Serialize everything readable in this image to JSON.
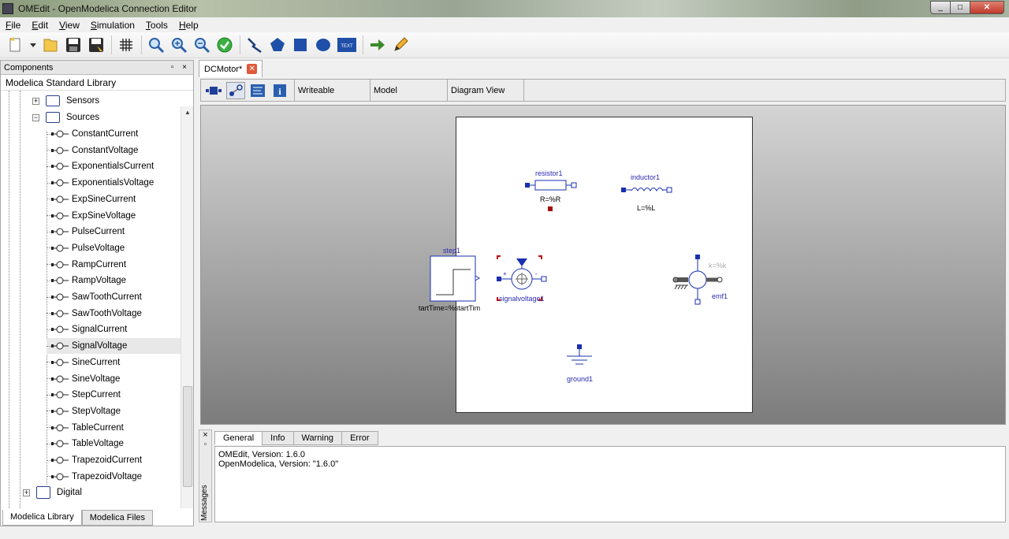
{
  "window": {
    "title": "OMEdit - OpenModelica Connection Editor",
    "min": "_",
    "max": "□",
    "close": "✕"
  },
  "menu": [
    {
      "label": "File",
      "u": "F",
      "rest": "ile"
    },
    {
      "label": "Edit",
      "u": "E",
      "rest": "dit"
    },
    {
      "label": "View",
      "u": "V",
      "rest": "iew"
    },
    {
      "label": "Simulation",
      "u": "S",
      "rest": "imulation"
    },
    {
      "label": "Tools",
      "u": "T",
      "rest": "ools"
    },
    {
      "label": "Help",
      "u": "H",
      "rest": "elp"
    }
  ],
  "toolbar": {
    "text_tool": "TEXT"
  },
  "components_panel": {
    "title": "Components",
    "controls": "▫ ×",
    "library_title": "Modelica Standard Library",
    "packages": [
      "Sensors",
      "Sources"
    ],
    "items": [
      "ConstantCurrent",
      "ConstantVoltage",
      "ExponentialsCurrent",
      "ExponentialsVoltage",
      "ExpSineCurrent",
      "ExpSineVoltage",
      "PulseCurrent",
      "PulseVoltage",
      "RampCurrent",
      "RampVoltage",
      "SawToothCurrent",
      "SawToothVoltage",
      "SignalCurrent",
      "SignalVoltage",
      "SineCurrent",
      "SineVoltage",
      "StepCurrent",
      "StepVoltage",
      "TableCurrent",
      "TableVoltage",
      "TrapezoidCurrent",
      "TrapezoidVoltage"
    ],
    "selected": "SignalVoltage",
    "after_packages": [
      "Digital"
    ],
    "tabs": [
      "Modelica Library",
      "Modelica Files"
    ]
  },
  "editor": {
    "tab_label": "DCMotor*",
    "tab_close": "✕",
    "status": [
      "Writeable",
      "Model",
      "Diagram View"
    ],
    "components": {
      "resistor": {
        "name": "resistor1",
        "param": "R=%R"
      },
      "inductor": {
        "name": "inductor1",
        "param": "L=%L"
      },
      "step": {
        "name": "step1",
        "param": "tartTime=%startTim"
      },
      "signalvoltage": {
        "name": "signalvoltage1"
      },
      "emf": {
        "name": "emf1",
        "param": "k=%k"
      },
      "ground": {
        "name": "ground1"
      }
    }
  },
  "messages": {
    "side_label": "Messages",
    "side_close": "×",
    "tabs": [
      "General",
      "Info",
      "Warning",
      "Error"
    ],
    "lines": [
      "OMEdit, Version: 1.6.0",
      "OpenModelica, Version: \"1.6.0\""
    ]
  },
  "colors": {
    "accent_blue": "#1a2fb0",
    "selection_red": "#c0392b",
    "diagram_bg": "#ffffff"
  }
}
